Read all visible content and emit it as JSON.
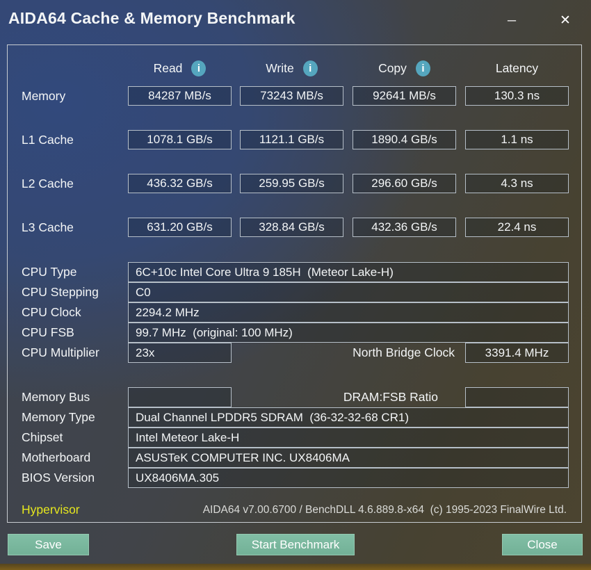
{
  "window": {
    "title": "AIDA64 Cache & Memory Benchmark"
  },
  "icons": {
    "minimize": "─",
    "close": "✕",
    "info": "i"
  },
  "benchmark_table": {
    "columns": [
      {
        "label": "Read"
      },
      {
        "label": "Write"
      },
      {
        "label": "Copy"
      },
      {
        "label": "Latency"
      }
    ],
    "rows": [
      {
        "label": "Memory",
        "read": "84287 MB/s",
        "write": "73243 MB/s",
        "copy": "92641 MB/s",
        "latency": "130.3 ns"
      },
      {
        "label": "L1 Cache",
        "read": "1078.1 GB/s",
        "write": "1121.1 GB/s",
        "copy": "1890.4 GB/s",
        "latency": "1.1 ns"
      },
      {
        "label": "L2 Cache",
        "read": "436.32 GB/s",
        "write": "259.95 GB/s",
        "copy": "296.60 GB/s",
        "latency": "4.3 ns"
      },
      {
        "label": "L3 Cache",
        "read": "631.20 GB/s",
        "write": "328.84 GB/s",
        "copy": "432.36 GB/s",
        "latency": "22.4 ns"
      }
    ]
  },
  "cpu_info": {
    "cpu_type": {
      "label": "CPU Type",
      "value": "6C+10c Intel Core Ultra 9 185H  (Meteor Lake-H)"
    },
    "cpu_stepping": {
      "label": "CPU Stepping",
      "value": "C0"
    },
    "cpu_clock": {
      "label": "CPU Clock",
      "value": "2294.2 MHz"
    },
    "cpu_fsb": {
      "label": "CPU FSB",
      "value": "99.7 MHz  (original: 100 MHz)"
    },
    "cpu_multiplier": {
      "label": "CPU Multiplier",
      "value": "23x"
    },
    "north_bridge": {
      "label": "North Bridge Clock",
      "value": "3391.4 MHz"
    }
  },
  "memory_info": {
    "memory_bus": {
      "label": "Memory Bus",
      "value": ""
    },
    "dram_fsb_ratio": {
      "label": "DRAM:FSB Ratio",
      "value": ""
    },
    "memory_type": {
      "label": "Memory Type",
      "value": "Dual Channel LPDDR5 SDRAM  (36-32-32-68 CR1)"
    },
    "chipset": {
      "label": "Chipset",
      "value": "Intel Meteor Lake-H"
    },
    "motherboard": {
      "label": "Motherboard",
      "value": "ASUSTeK COMPUTER INC. UX8406MA"
    },
    "bios_version": {
      "label": "BIOS Version",
      "value": "UX8406MA.305"
    }
  },
  "footer": {
    "hypervisor_label": "Hypervisor",
    "version_text": "AIDA64 v7.00.6700 / BenchDLL 4.6.889.8-x64  (c) 1995-2023 FinalWire Ltd."
  },
  "buttons": {
    "save": "Save",
    "start_benchmark": "Start Benchmark",
    "close": "Close"
  },
  "colors": {
    "info_icon": "#55a6be",
    "button_accent": "#79b79e",
    "hypervisor_text": "#e6e71e",
    "bottom_bar": "#6b5118",
    "background_blue": "#32497c",
    "background_olive": "#4c4430"
  }
}
